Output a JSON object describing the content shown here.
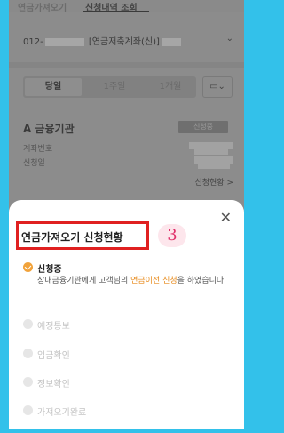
{
  "tabs": [
    "연금가져오기",
    "신청내역 조회"
  ],
  "account": {
    "prefix": "012-",
    "label": "[연금저축계좌(신)]",
    "chevron": "⌄"
  },
  "period": {
    "options": [
      "당일",
      "1주일",
      "1개월"
    ],
    "selected": "당일",
    "calendar_icon": "▭⌄"
  },
  "institution": {
    "name": "A 금융기관",
    "badge": "신청중",
    "account_label": "계좌번호",
    "date_label": "신청일",
    "status_link": "신청현황 >"
  },
  "sheet": {
    "close": "✕",
    "title": "연금가져오기 신청현황",
    "step_marker": "3",
    "steps": [
      {
        "label": "신청중",
        "active": true
      },
      {
        "label": "예정통보",
        "active": false
      },
      {
        "label": "입금확인",
        "active": false
      },
      {
        "label": "정보확인",
        "active": false
      },
      {
        "label": "가져오기완료",
        "active": false
      }
    ],
    "desc_prefix": "상대금융기관에게 고객님의 ",
    "desc_highlight": "연금이전 신청",
    "desc_suffix": "을 하였습니다."
  }
}
